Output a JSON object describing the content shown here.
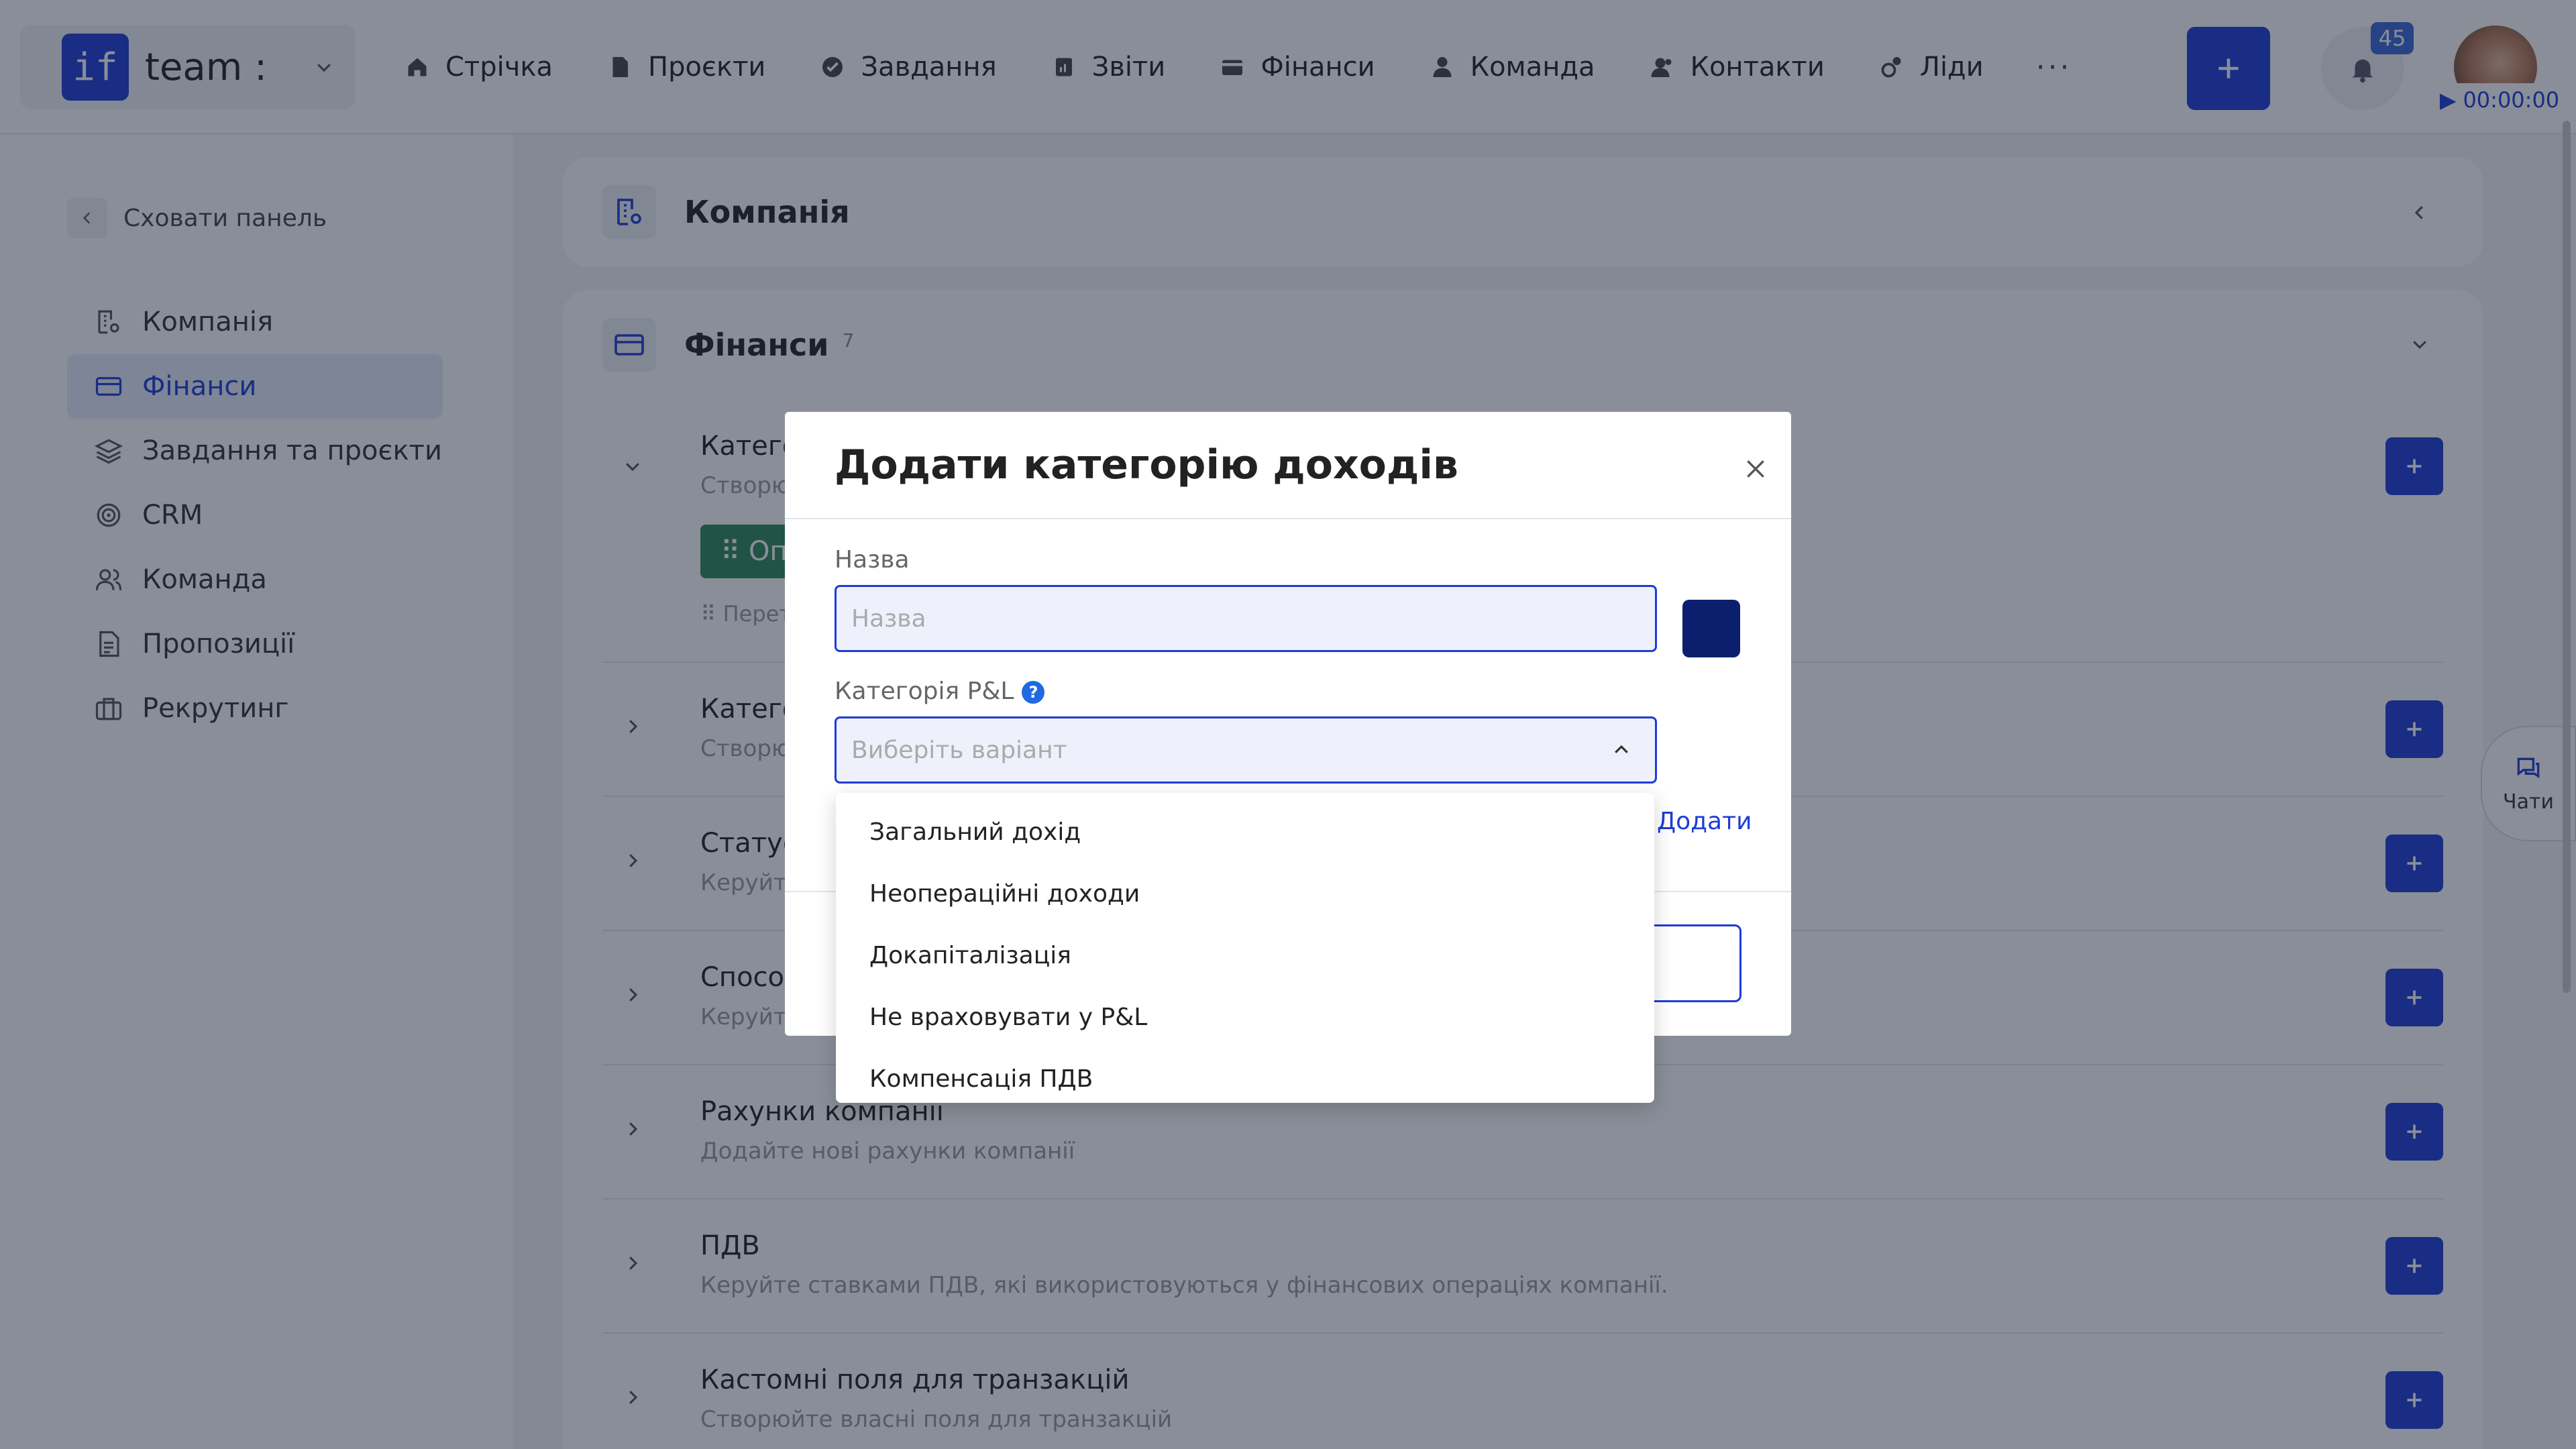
{
  "brand": {
    "logo_text": "if",
    "name": "team :"
  },
  "nav": [
    {
      "label": "Стрічка",
      "icon": "home-icon"
    },
    {
      "label": "Проєкти",
      "icon": "document-icon"
    },
    {
      "label": "Завдання",
      "icon": "check-circle-icon"
    },
    {
      "label": "Звіти",
      "icon": "report-icon"
    },
    {
      "label": "Фінанси",
      "icon": "wallet-icon"
    },
    {
      "label": "Команда",
      "icon": "user-icon"
    },
    {
      "label": "Контакти",
      "icon": "contacts-icon"
    },
    {
      "label": "Ліди",
      "icon": "leads-icon"
    }
  ],
  "nav_more": "···",
  "notifications": {
    "count": "45"
  },
  "timer": {
    "value": "00:00:00"
  },
  "sidebar": {
    "hide_label": "Сховати панель",
    "items": [
      {
        "label": "Компанія",
        "icon": "company-icon",
        "active": false
      },
      {
        "label": "Фінанси",
        "icon": "card-icon",
        "active": true
      },
      {
        "label": "Завдання та проєкти",
        "icon": "layers-icon",
        "active": false
      },
      {
        "label": "CRM",
        "icon": "target-icon",
        "active": false
      },
      {
        "label": "Команда",
        "icon": "users-icon",
        "active": false
      },
      {
        "label": "Пропозиції",
        "icon": "file-icon",
        "active": false
      },
      {
        "label": "Рекрутинг",
        "icon": "briefcase-icon",
        "active": false
      }
    ]
  },
  "main": {
    "company_title": "Компанія",
    "finance_title": "Фінанси",
    "finance_count": "7",
    "rows": [
      {
        "title": "Категорії",
        "desc": "Створюйте"
      },
      {
        "title": "Категорії",
        "desc": "Створюйте"
      },
      {
        "title": "Статуси т",
        "desc": "Керуйте ст"
      },
      {
        "title": "Способи о",
        "desc": "Керуйте сп"
      },
      {
        "title": "Рахунки компанії",
        "desc": "Додайте нові рахунки компанії"
      },
      {
        "title": "ПДВ",
        "desc": "Керуйте ставками ПДВ, які використовуються у фінансових операціях компанії."
      },
      {
        "title": "Кастомні поля для транзакцій",
        "desc": "Створюйте власні поля для транзакцій"
      }
    ],
    "tag_label": "⠿ Оплата",
    "drag_hint": "⠿ Перетяг"
  },
  "chat": {
    "label": "Чати"
  },
  "modal": {
    "title": "Додати категорію доходів",
    "name_label": "Назва",
    "name_placeholder": "Назва",
    "color": "#0c1f6e",
    "pl_label": "Категорія P&L",
    "pl_placeholder": "Виберіть варіант",
    "add_link": "Додати",
    "options": [
      "Загальний дохід",
      "Неопераційні доходи",
      "Докапіталізація",
      "Не враховувати у P&L",
      "Компенсація ПДВ"
    ]
  },
  "colors": {
    "accent": "#1e3cd6",
    "green": "#2e8b57"
  }
}
